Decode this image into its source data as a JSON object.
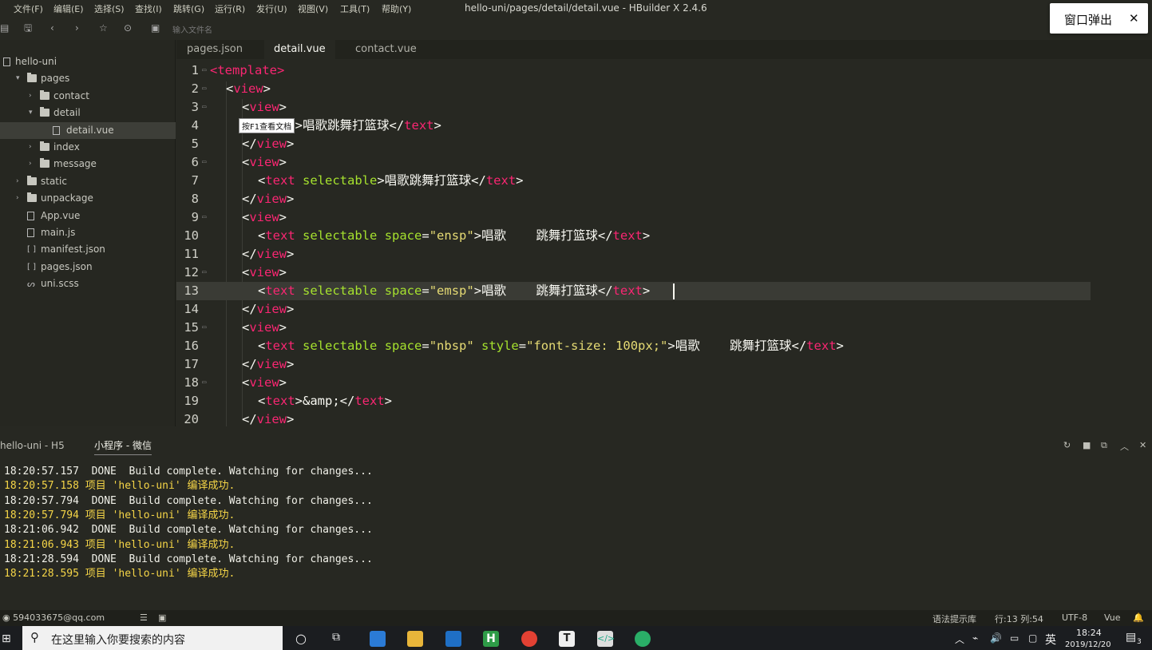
{
  "menubar": {
    "items": [
      "文件(F)",
      "编辑(E)",
      "选择(S)",
      "查找(I)",
      "跳转(G)",
      "运行(R)",
      "发行(U)",
      "视图(V)",
      "工具(T)",
      "帮助(Y)"
    ],
    "title": "hello-uni/pages/detail/detail.vue - HBuilder X 2.4.6"
  },
  "toolbar": {
    "search_placeholder": "输入文件名"
  },
  "popup": {
    "label": "窗口弹出",
    "close": "✕"
  },
  "sidebar": {
    "items": [
      {
        "label": "hello-uni",
        "type": "project",
        "indent": 0
      },
      {
        "label": "pages",
        "type": "folder",
        "indent": 1,
        "open": true
      },
      {
        "label": "contact",
        "type": "folder",
        "indent": 2,
        "open": false
      },
      {
        "label": "detail",
        "type": "folder",
        "indent": 2,
        "open": true
      },
      {
        "label": "detail.vue",
        "type": "file",
        "indent": 3,
        "selected": true
      },
      {
        "label": "index",
        "type": "folder",
        "indent": 2,
        "open": false
      },
      {
        "label": "message",
        "type": "folder",
        "indent": 2,
        "open": false
      },
      {
        "label": "static",
        "type": "folder",
        "indent": 1,
        "open": false
      },
      {
        "label": "unpackage",
        "type": "folder",
        "indent": 1,
        "open": false
      },
      {
        "label": "App.vue",
        "type": "file",
        "indent": 1
      },
      {
        "label": "main.js",
        "type": "file",
        "indent": 1
      },
      {
        "label": "manifest.json",
        "type": "json",
        "indent": 1
      },
      {
        "label": "pages.json",
        "type": "json",
        "indent": 1
      },
      {
        "label": "uni.scss",
        "type": "style",
        "indent": 1
      }
    ]
  },
  "tabs": [
    {
      "label": "pages.json",
      "active": false
    },
    {
      "label": "detail.vue",
      "active": true
    },
    {
      "label": "contact.vue",
      "active": false
    }
  ],
  "editor": {
    "tooltip": "按F1查看文档",
    "lines": [
      {
        "num": "1",
        "indent": 0,
        "tokens": [
          [
            "tag",
            "<template>"
          ]
        ]
      },
      {
        "num": "2",
        "indent": 1,
        "tokens": [
          [
            "p",
            "<"
          ],
          [
            "tag",
            "view"
          ],
          [
            "p",
            ">"
          ]
        ]
      },
      {
        "num": "3",
        "indent": 2,
        "tokens": [
          [
            "p",
            "<"
          ],
          [
            "tag",
            "view"
          ],
          [
            "p",
            ">"
          ]
        ]
      },
      {
        "num": "4",
        "indent": 3,
        "tokens": [
          [
            "p",
            "<"
          ],
          [
            "tag",
            "text"
          ],
          [
            "p",
            ">唱歌跳舞打篮球</"
          ],
          [
            "tag",
            "text"
          ],
          [
            "p",
            ">"
          ]
        ]
      },
      {
        "num": "5",
        "indent": 2,
        "tokens": [
          [
            "p",
            "</"
          ],
          [
            "tag",
            "view"
          ],
          [
            "p",
            ">"
          ]
        ]
      },
      {
        "num": "6",
        "indent": 2,
        "tokens": [
          [
            "p",
            "<"
          ],
          [
            "tag",
            "view"
          ],
          [
            "p",
            ">"
          ]
        ]
      },
      {
        "num": "7",
        "indent": 3,
        "tokens": [
          [
            "p",
            "<"
          ],
          [
            "tag",
            "text"
          ],
          [
            "p",
            " "
          ],
          [
            "attr",
            "selectable"
          ],
          [
            "p",
            ">唱歌跳舞打篮球</"
          ],
          [
            "tag",
            "text"
          ],
          [
            "p",
            ">"
          ]
        ]
      },
      {
        "num": "8",
        "indent": 2,
        "tokens": [
          [
            "p",
            "</"
          ],
          [
            "tag",
            "view"
          ],
          [
            "p",
            ">"
          ]
        ]
      },
      {
        "num": "9",
        "indent": 2,
        "tokens": [
          [
            "p",
            "<"
          ],
          [
            "tag",
            "view"
          ],
          [
            "p",
            ">"
          ]
        ]
      },
      {
        "num": "10",
        "indent": 3,
        "tokens": [
          [
            "p",
            "<"
          ],
          [
            "tag",
            "text"
          ],
          [
            "p",
            " "
          ],
          [
            "attr",
            "selectable"
          ],
          [
            "p",
            " "
          ],
          [
            "attr",
            "space"
          ],
          [
            "p",
            "="
          ],
          [
            "str",
            "\"ensp\""
          ],
          [
            "p",
            ">唱歌    跳舞打篮球</"
          ],
          [
            "tag",
            "text"
          ],
          [
            "p",
            ">"
          ]
        ]
      },
      {
        "num": "11",
        "indent": 2,
        "tokens": [
          [
            "p",
            "</"
          ],
          [
            "tag",
            "view"
          ],
          [
            "p",
            ">"
          ]
        ]
      },
      {
        "num": "12",
        "indent": 2,
        "tokens": [
          [
            "p",
            "<"
          ],
          [
            "tag",
            "view"
          ],
          [
            "p",
            ">"
          ]
        ]
      },
      {
        "num": "13",
        "indent": 3,
        "tokens": [
          [
            "p",
            "<"
          ],
          [
            "tag",
            "text"
          ],
          [
            "p",
            " "
          ],
          [
            "attr",
            "selectable"
          ],
          [
            "p",
            " "
          ],
          [
            "attr",
            "space"
          ],
          [
            "p",
            "="
          ],
          [
            "str",
            "\"emsp\""
          ],
          [
            "p",
            ">唱歌    跳舞打篮球</"
          ],
          [
            "tag",
            "text"
          ],
          [
            "p",
            ">"
          ]
        ]
      },
      {
        "num": "14",
        "indent": 2,
        "tokens": [
          [
            "p",
            "</"
          ],
          [
            "tag",
            "view"
          ],
          [
            "p",
            ">"
          ]
        ]
      },
      {
        "num": "15",
        "indent": 2,
        "tokens": [
          [
            "p",
            "<"
          ],
          [
            "tag",
            "view"
          ],
          [
            "p",
            ">"
          ]
        ]
      },
      {
        "num": "16",
        "indent": 3,
        "tokens": [
          [
            "p",
            "<"
          ],
          [
            "tag",
            "text"
          ],
          [
            "p",
            " "
          ],
          [
            "attr",
            "selectable"
          ],
          [
            "p",
            " "
          ],
          [
            "attr",
            "space"
          ],
          [
            "p",
            "="
          ],
          [
            "str",
            "\"nbsp\""
          ],
          [
            "p",
            " "
          ],
          [
            "attr",
            "style"
          ],
          [
            "p",
            "="
          ],
          [
            "str",
            "\"font-size: 100px;\""
          ],
          [
            "p",
            ">唱歌    跳舞打篮球</"
          ],
          [
            "tag",
            "text"
          ],
          [
            "p",
            ">"
          ]
        ]
      },
      {
        "num": "17",
        "indent": 2,
        "tokens": [
          [
            "p",
            "</"
          ],
          [
            "tag",
            "view"
          ],
          [
            "p",
            ">"
          ]
        ]
      },
      {
        "num": "18",
        "indent": 2,
        "tokens": [
          [
            "p",
            "<"
          ],
          [
            "tag",
            "view"
          ],
          [
            "p",
            ">"
          ]
        ]
      },
      {
        "num": "19",
        "indent": 3,
        "tokens": [
          [
            "p",
            "<"
          ],
          [
            "tag",
            "text"
          ],
          [
            "p",
            ">&amp;</"
          ],
          [
            "tag",
            "text"
          ],
          [
            "p",
            ">"
          ]
        ]
      },
      {
        "num": "20",
        "indent": 2,
        "tokens": [
          [
            "p",
            "</"
          ],
          [
            "tag",
            "view"
          ],
          [
            "p",
            ">"
          ]
        ]
      }
    ]
  },
  "panel": {
    "tabs": [
      {
        "label": "hello-uni - H5",
        "active": false
      },
      {
        "label": "小程序 - 微信",
        "active": true
      }
    ],
    "console": [
      {
        "text": "18:20:57.157  DONE  Build complete. Watching for changes...",
        "style": "white"
      },
      {
        "text": "18:20:57.158 项目 'hello-uni' 编译成功.",
        "style": "yellow"
      },
      {
        "text": "18:20:57.794  DONE  Build complete. Watching for changes...",
        "style": "white"
      },
      {
        "text": "18:20:57.794 项目 'hello-uni' 编译成功.",
        "style": "yellow"
      },
      {
        "text": "18:21:06.942  DONE  Build complete. Watching for changes...",
        "style": "white"
      },
      {
        "text": "18:21:06.943 项目 'hello-uni' 编译成功.",
        "style": "yellow"
      },
      {
        "text": "18:21:28.594  DONE  Build complete. Watching for changes...",
        "style": "white"
      },
      {
        "text": "18:21:28.595 项目 'hello-uni' 编译成功.",
        "style": "yellow"
      }
    ]
  },
  "statusbar": {
    "account": "594033675@qq.com",
    "syntax": "语法提示库",
    "position": "行:13  列:54",
    "encoding": "UTF-8",
    "language": "Vue"
  },
  "taskbar": {
    "search_placeholder": "在这里输入你要搜索的内容",
    "ime": "英",
    "time": "18:24",
    "date": "2019/12/20",
    "notifications": "3"
  },
  "colors": {
    "tag": "#f92672",
    "attr": "#a6e22e",
    "string": "#e6db74",
    "console_yellow": "#f5d547",
    "background": "#272822"
  }
}
